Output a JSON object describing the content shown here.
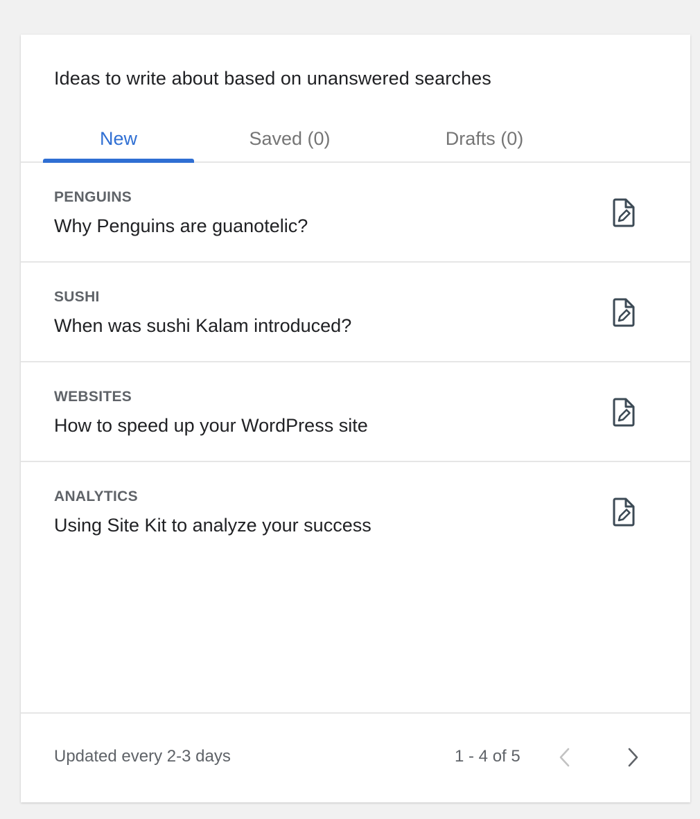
{
  "card": {
    "title": "Ideas to write about based on unanswered searches"
  },
  "tabs": [
    {
      "label": "New",
      "active": true
    },
    {
      "label": "Saved (0)",
      "active": false
    },
    {
      "label": "Drafts (0)",
      "active": false
    }
  ],
  "ideas": [
    {
      "topic": "PENGUINS",
      "title": "Why Penguins are guanotelic?",
      "icon": "create-draft-icon"
    },
    {
      "topic": "SUSHI",
      "title": "When was sushi Kalam introduced?",
      "icon": "create-draft-icon"
    },
    {
      "topic": "WEBSITES",
      "title": "How to speed up your WordPress site",
      "icon": "create-draft-icon"
    },
    {
      "topic": "ANALYTICS",
      "title": "Using Site Kit to analyze your success",
      "icon": "create-draft-icon"
    }
  ],
  "footer": {
    "note": "Updated every 2-3 days",
    "pagination": "1 - 4 of 5",
    "prev_icon": "chevron-left-icon",
    "next_icon": "chevron-right-icon"
  },
  "colors": {
    "accent": "#2f6fd3",
    "text_primary": "#202124",
    "text_secondary": "#5f6368",
    "divider": "#e6e6e6",
    "icon": "#3c4a55"
  }
}
